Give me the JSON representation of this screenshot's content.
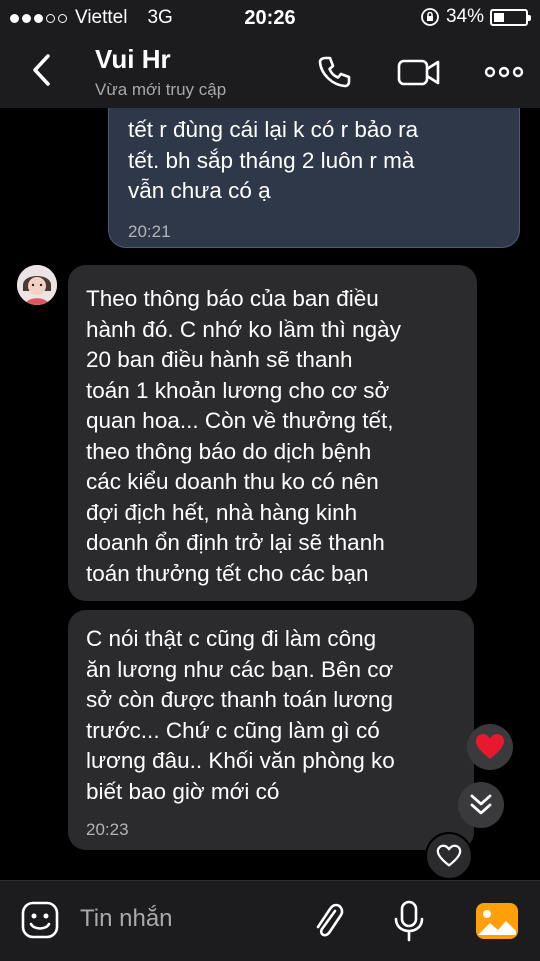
{
  "status_bar": {
    "carrier": "Viettel",
    "network": "3G",
    "time": "20:26",
    "battery": "34%",
    "battery_level": 0.34
  },
  "header": {
    "name": "Vui Hr",
    "status": "Vừa mới truy cập"
  },
  "messages": [
    {
      "direction": "outgoing",
      "text": "tết r đùng cái lại k có r bảo ra\ntết. bh sắp tháng 2 luôn r mà\nvẫn chưa có ạ",
      "time": "20:21"
    },
    {
      "direction": "incoming",
      "text": "Theo thông báo của ban điều\nhành đó. C nhớ ko lầm thì ngày\n20 ban điều hành sẽ thanh\ntoán 1 khoản lương cho cơ sở\nquan hoa... Còn về thưởng tết,\ntheo thông báo do dịch bệnh\ncác kiểu doanh thu ko có nên\nđợi địch hết, nhà hàng kinh\ndoanh ổn định trở lại sẽ thanh\ntoán thưởng tết cho các bạn"
    },
    {
      "direction": "incoming",
      "text": "C nói thật c cũng đi làm công\năn lương như các bạn. Bên cơ\nsở còn được thanh toán lương\ntrước... Chứ c cũng làm gì có\nlương đâu.. Khối văn phòng ko\nbiết bao giờ mới có",
      "time": "20:23"
    }
  ],
  "input": {
    "placeholder": "Tin nhắn"
  },
  "colors": {
    "background": "#000000",
    "bar": "#1c1c1e",
    "outgoing_bubble": "#2e3848",
    "incoming_bubble": "#2b2b2d",
    "accent": "#ffffff",
    "heart": "#e8182f",
    "image_icon": "#ff9f0a"
  },
  "icons": {
    "back": "chevron-left-icon",
    "call": "phone-icon",
    "video": "video-camera-icon",
    "more": "more-horizontal-icon",
    "reaction": "heart-icon",
    "scroll": "double-chevron-down-icon",
    "like": "heart-outline-icon",
    "emoji": "emoji-icon",
    "attach": "paperclip-icon",
    "mic": "microphone-icon",
    "image": "image-icon"
  }
}
